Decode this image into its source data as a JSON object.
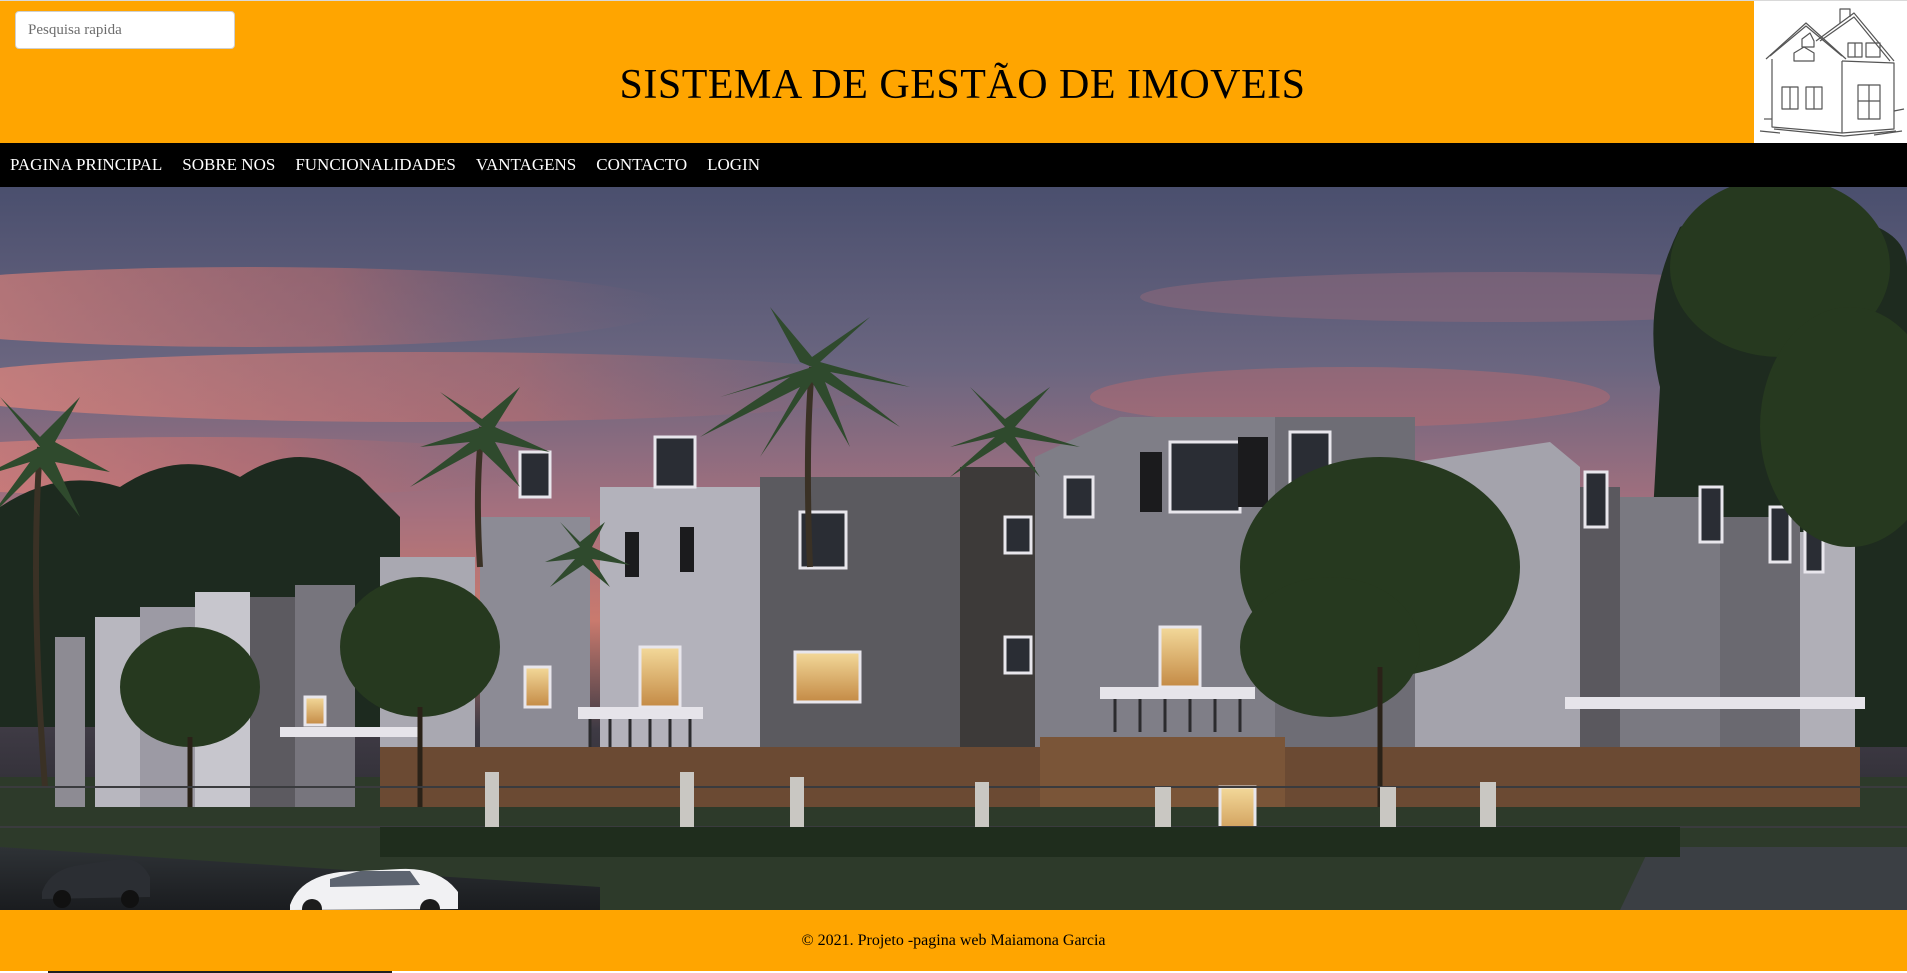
{
  "search": {
    "placeholder": "Pesquisa rapida"
  },
  "header": {
    "title": "SISTEMA DE GESTÃO DE IMOVEIS",
    "logo_icon": "house-sketch-icon"
  },
  "nav": {
    "items": [
      {
        "label": "PAGINA PRINCIPAL"
      },
      {
        "label": "SOBRE NOS"
      },
      {
        "label": "FUNCIONALIDADES"
      },
      {
        "label": "VANTAGENS"
      },
      {
        "label": "CONTACTO"
      },
      {
        "label": "LOGIN"
      }
    ]
  },
  "footer": {
    "text": "© 2021. Projeto -pagina web Maiamona Garcia"
  },
  "colors": {
    "header_bg": "#ffa500",
    "nav_bg": "#000000",
    "nav_text": "#ffffff",
    "footer_bg": "#ffa500"
  }
}
